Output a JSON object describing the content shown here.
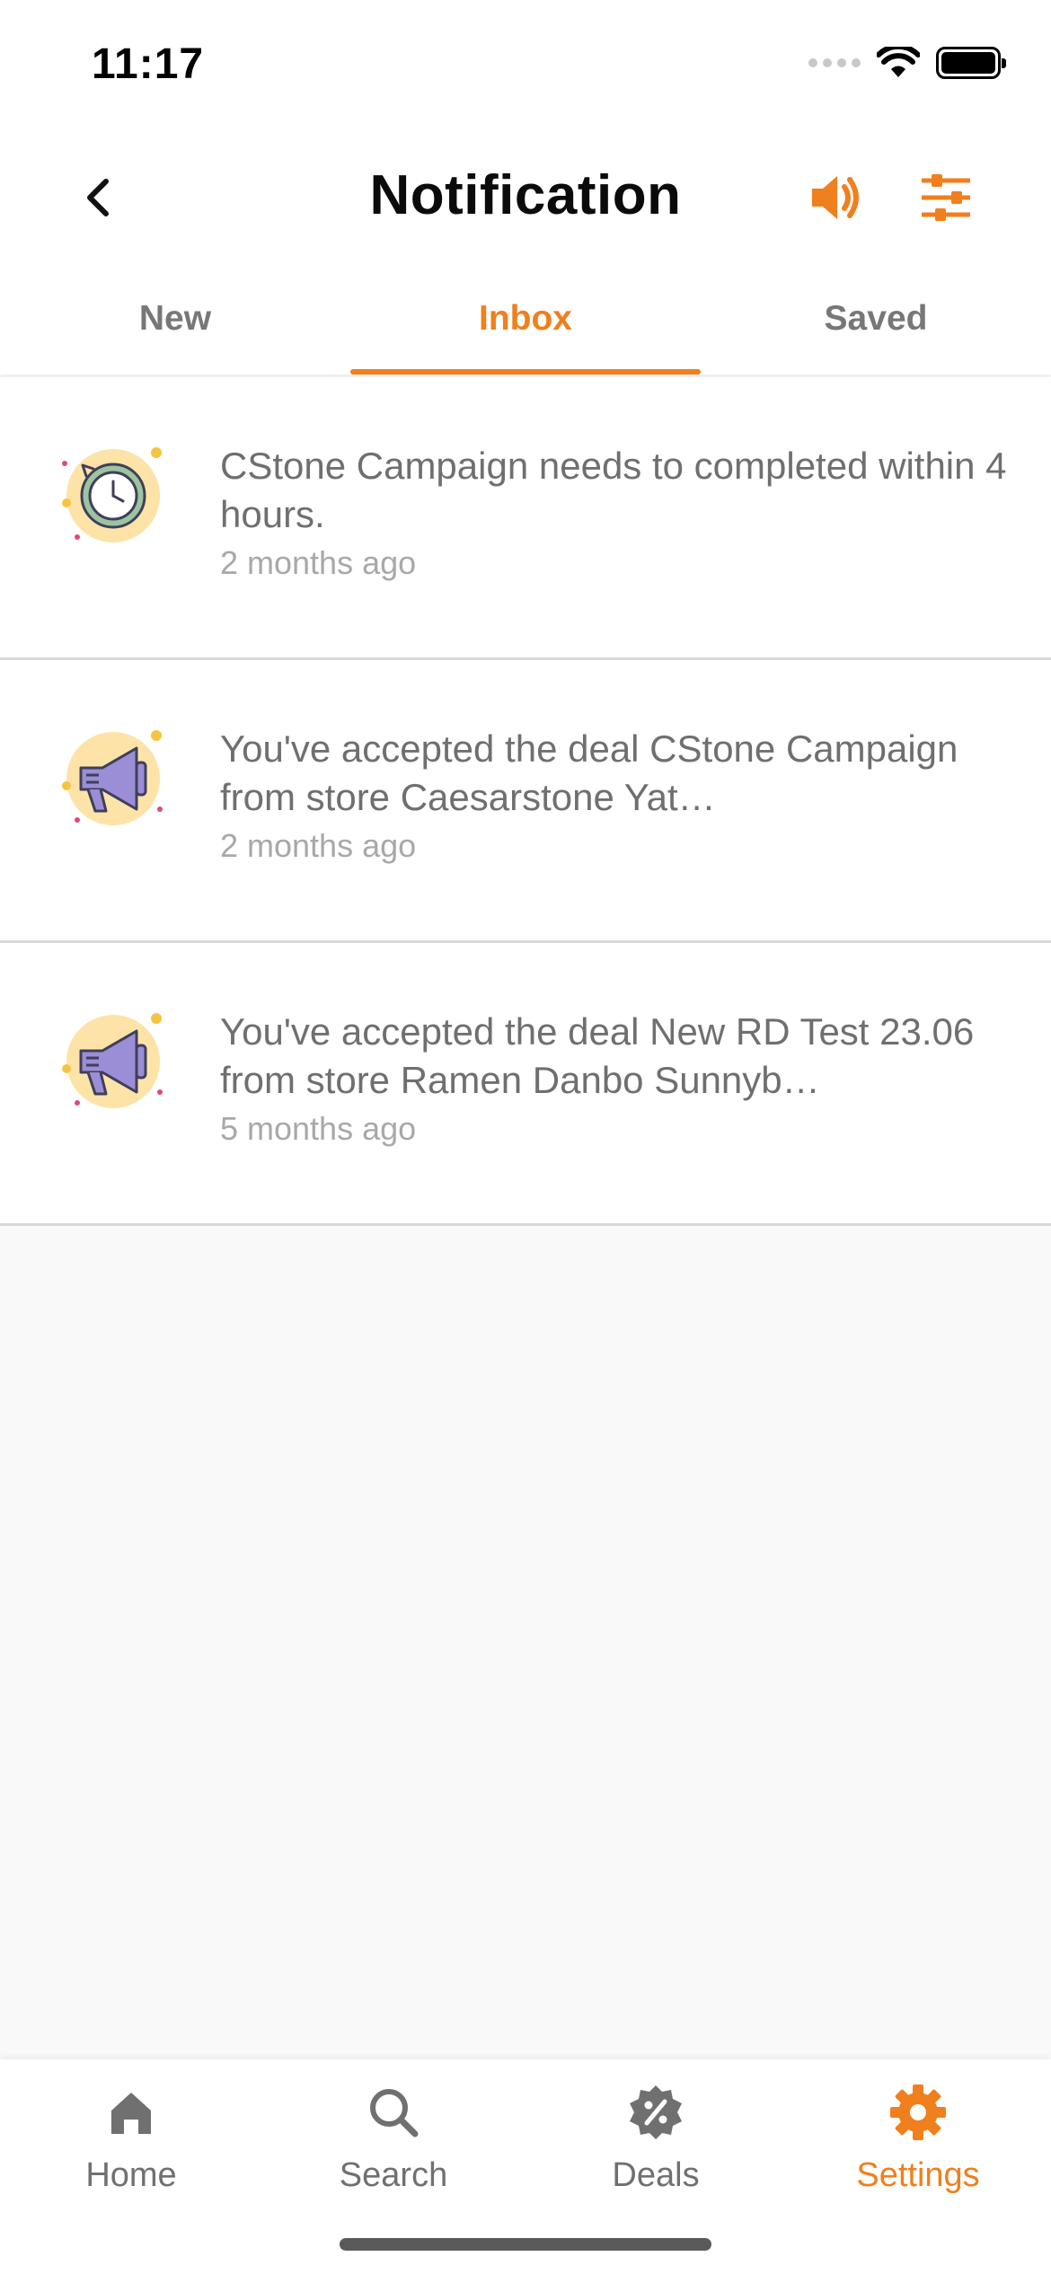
{
  "status_bar": {
    "time": "11:17"
  },
  "header": {
    "title": "Notification"
  },
  "tabs": [
    {
      "label": "New",
      "active": false
    },
    {
      "label": "Inbox",
      "active": true
    },
    {
      "label": "Saved",
      "active": false
    }
  ],
  "notifications": [
    {
      "icon": "clock-icon",
      "text": "CStone Campaign needs to completed within 4 hours.",
      "time": "2 months ago"
    },
    {
      "icon": "megaphone-icon",
      "text": "You've accepted the deal CStone Campaign from store Caesarstone Yat…",
      "time": "2 months ago"
    },
    {
      "icon": "megaphone-icon",
      "text": "You've accepted the deal New RD Test 23.06 from store Ramen Danbo  Sunnyb…",
      "time": "5 months ago"
    }
  ],
  "bottom_nav": [
    {
      "label": "Home",
      "icon": "home-icon",
      "active": false
    },
    {
      "label": "Search",
      "icon": "search-icon",
      "active": false
    },
    {
      "label": "Deals",
      "icon": "deals-icon",
      "active": false
    },
    {
      "label": "Settings",
      "icon": "gear-icon",
      "active": true
    }
  ],
  "colors": {
    "accent": "#f07f1d",
    "inactive": "#707070",
    "background": "#f9f9f9"
  }
}
